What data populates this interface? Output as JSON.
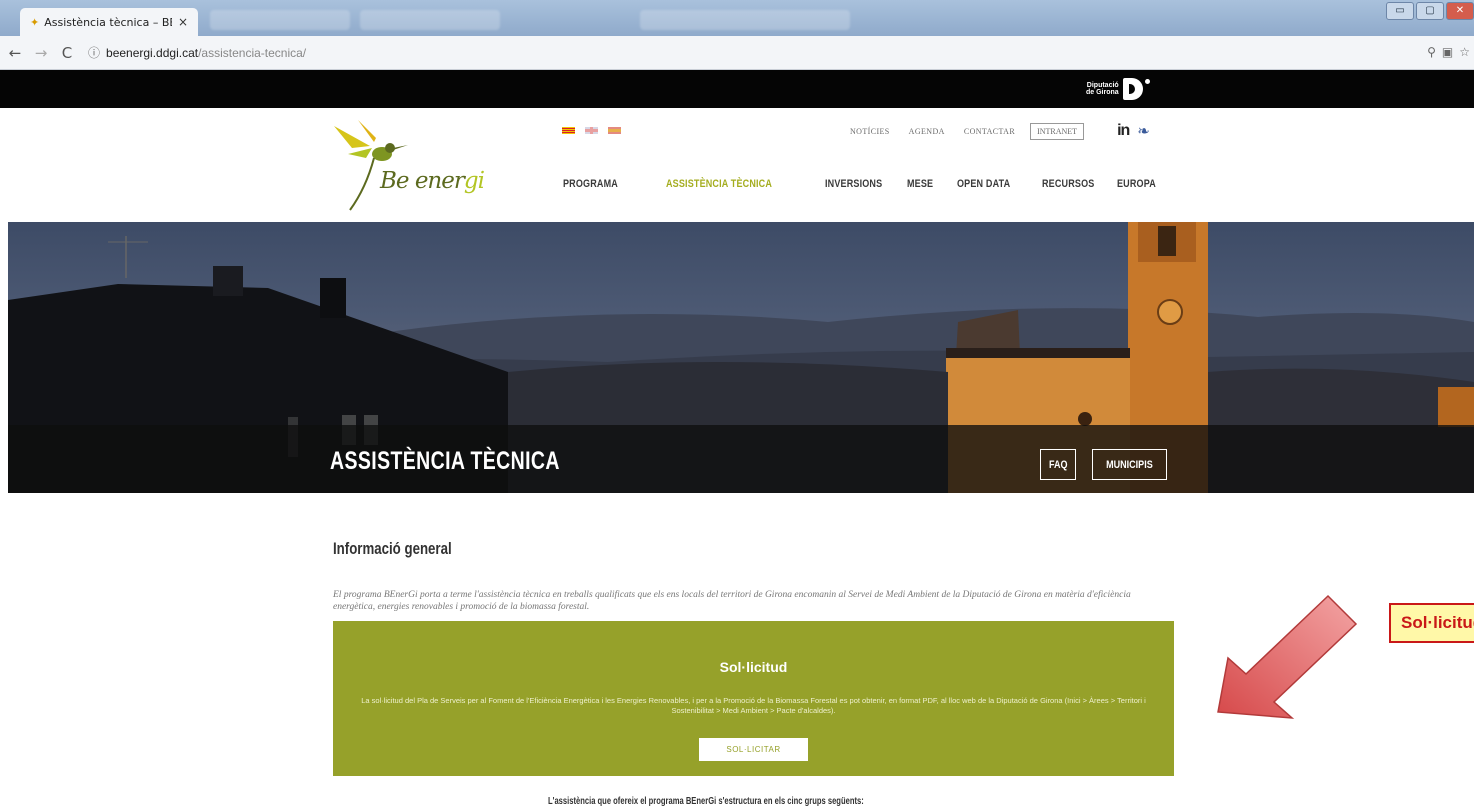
{
  "browser": {
    "active_tab": {
      "title": "Assistència tècnica – BE",
      "close": "×"
    },
    "url": {
      "host": "beenergi.ddgi.cat",
      "path": "/assistencia-tecnica/"
    },
    "nav": {
      "back": "←",
      "forward": "→",
      "reload": "C",
      "info": "ⓘ"
    },
    "window_buttons": {
      "minimize": "▭",
      "maximize": "▢",
      "close": "✕"
    }
  },
  "site": {
    "diputacio": {
      "line1": "Diputació",
      "line2": "de Girona"
    },
    "logo": {
      "name_part1": "Be ener",
      "name_part2": "gi"
    },
    "util_nav": [
      "NOTÍCIES",
      "AGENDA",
      "CONTACTAR"
    ],
    "intranet": "INTRANET",
    "social": {
      "linkedin": "in",
      "twitter": "🐦"
    },
    "main_nav": [
      "PROGRAMA",
      "ASSISTÈNCIA TÈCNICA",
      "INVERSIONS",
      "MESE",
      "OPEN DATA",
      "RECURSOS",
      "EUROPA"
    ],
    "hero": {
      "title": "ASSISTÈNCIA TÈCNICA",
      "btn_faq": "FAQ",
      "btn_municipis": "MUNICIPIS"
    },
    "section": {
      "title": "Informació general",
      "intro": "El programa BEnerGi porta a terme l'assistència tècnica en treballs qualificats que els ens locals del territori de Girona encomanin al Servei de Medi Ambient de la Diputació de Girona en matèria d'eficiència energètica, energies renovables i promoció de la biomassa forestal."
    },
    "solicitud": {
      "title": "Sol·licitud",
      "text": "La sol·licitud del Pla de Serveis per al Foment de l'Eficiència Energètica i les Energies Renovables, i per a la Promoció de la Biomassa Forestal es pot obtenir, en format PDF, al lloc web de la Diputació de Girona (Inici > Àrees > Territori i Sostenibilitat > Medi Ambient > Pacte d'alcaldes).",
      "button": "SOL·LICITAR"
    },
    "bottom": "L'assistència que ofereix el programa BEnerGi s'estructura en els cinc grups següents:"
  },
  "annotation": {
    "label": "Sol·licitud"
  },
  "colors": {
    "accent": "#96a12a",
    "nav_active": "#a4ad1f",
    "callout_border": "#c91818",
    "callout_bg": "#fff8a8"
  }
}
